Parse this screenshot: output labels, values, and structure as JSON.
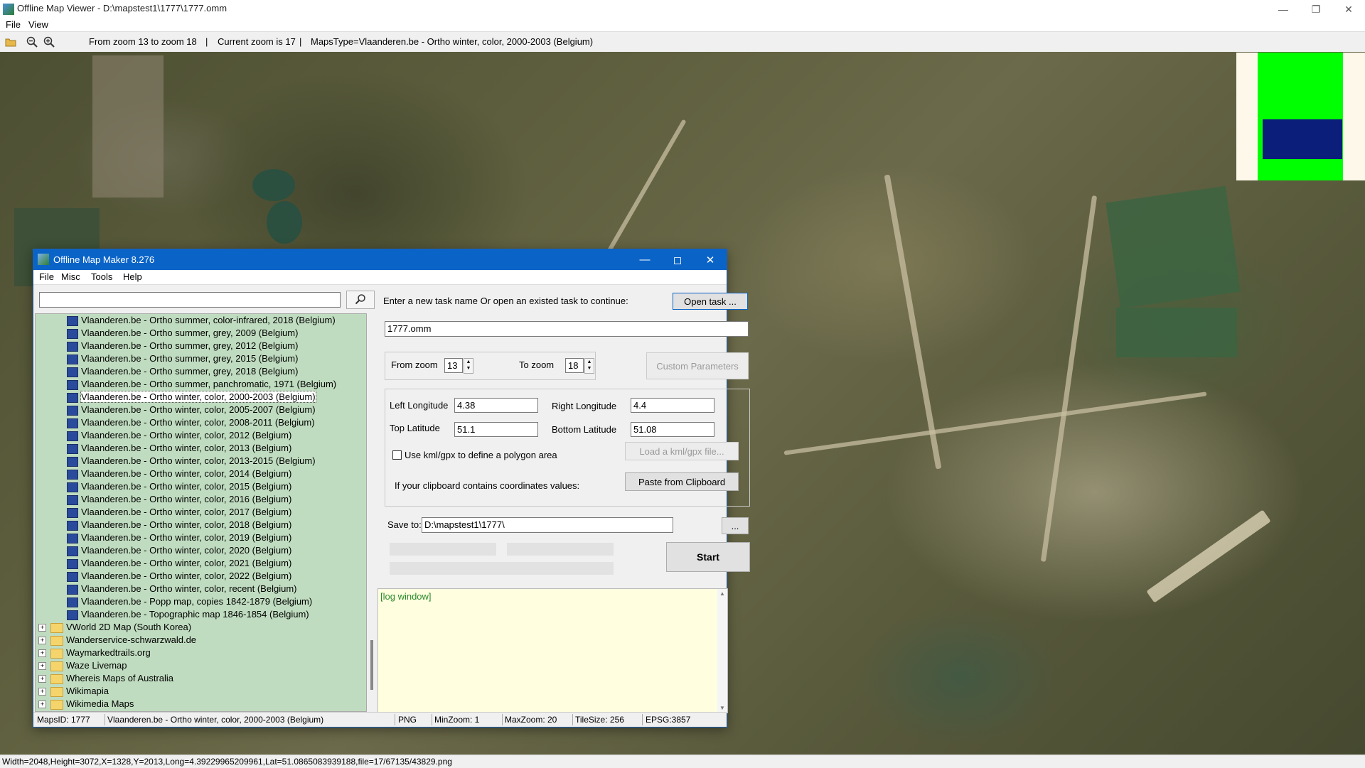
{
  "viewer": {
    "title": "Offline Map Viewer - D:\\mapstest1\\1777\\1777.omm",
    "menu": [
      "File",
      "View"
    ],
    "toolbar": {
      "zoom_range": "From zoom 13 to zoom 18",
      "separator": "|",
      "current_zoom": "Current zoom is 17",
      "separator2": "|",
      "maps_type": "MapsType=Vlaanderen.be - Ortho winter, color, 2000-2003 (Belgium)",
      "icons": [
        "folder-open-icon",
        "zoom-out-icon",
        "zoom-in-icon"
      ]
    },
    "status": "Width=2048,Height=3072,X=1328,Y=2013,Long=4.39229965209961,Lat=51.0865083939188,file=17/67135/43829.png",
    "overview_colors": {
      "background": "#fdf8ea",
      "frame": "#00ff00",
      "viewport": "#0a1e7a"
    }
  },
  "dialog": {
    "title": "Offline Map Maker 8.276",
    "menu": [
      "File",
      "Misc",
      "Tools",
      "Help"
    ],
    "search": {
      "value": "",
      "icon": "search-icon"
    },
    "tree_items": [
      {
        "label": "Vlaanderen.be - Ortho summer, color-infrared, 2018 (Belgium)",
        "type": "map"
      },
      {
        "label": "Vlaanderen.be - Ortho summer, grey, 2009 (Belgium)",
        "type": "map"
      },
      {
        "label": "Vlaanderen.be - Ortho summer, grey, 2012 (Belgium)",
        "type": "map"
      },
      {
        "label": "Vlaanderen.be - Ortho summer, grey, 2015 (Belgium)",
        "type": "map"
      },
      {
        "label": "Vlaanderen.be - Ortho summer, grey, 2018 (Belgium)",
        "type": "map"
      },
      {
        "label": "Vlaanderen.be - Ortho summer, panchromatic, 1971 (Belgium)",
        "type": "map"
      },
      {
        "label": "Vlaanderen.be - Ortho winter, color, 2000-2003 (Belgium)",
        "type": "map",
        "selected": true
      },
      {
        "label": "Vlaanderen.be - Ortho winter, color, 2005-2007 (Belgium)",
        "type": "map"
      },
      {
        "label": "Vlaanderen.be - Ortho winter, color, 2008-2011 (Belgium)",
        "type": "map"
      },
      {
        "label": "Vlaanderen.be - Ortho winter, color, 2012 (Belgium)",
        "type": "map"
      },
      {
        "label": "Vlaanderen.be - Ortho winter, color, 2013 (Belgium)",
        "type": "map"
      },
      {
        "label": "Vlaanderen.be - Ortho winter, color, 2013-2015 (Belgium)",
        "type": "map"
      },
      {
        "label": "Vlaanderen.be - Ortho winter, color, 2014 (Belgium)",
        "type": "map"
      },
      {
        "label": "Vlaanderen.be - Ortho winter, color, 2015 (Belgium)",
        "type": "map"
      },
      {
        "label": "Vlaanderen.be - Ortho winter, color, 2016 (Belgium)",
        "type": "map"
      },
      {
        "label": "Vlaanderen.be - Ortho winter, color, 2017 (Belgium)",
        "type": "map"
      },
      {
        "label": "Vlaanderen.be - Ortho winter, color, 2018 (Belgium)",
        "type": "map"
      },
      {
        "label": "Vlaanderen.be - Ortho winter, color, 2019 (Belgium)",
        "type": "map"
      },
      {
        "label": "Vlaanderen.be - Ortho winter, color, 2020 (Belgium)",
        "type": "map"
      },
      {
        "label": "Vlaanderen.be - Ortho winter, color, 2021 (Belgium)",
        "type": "map"
      },
      {
        "label": "Vlaanderen.be - Ortho winter, color, 2022 (Belgium)",
        "type": "map"
      },
      {
        "label": "Vlaanderen.be - Ortho winter, color, recent (Belgium)",
        "type": "map"
      },
      {
        "label": "Vlaanderen.be - Popp map, copies 1842-1879 (Belgium)",
        "type": "map"
      },
      {
        "label": "Vlaanderen.be - Topographic map 1846-1854 (Belgium)",
        "type": "map"
      },
      {
        "label": "VWorld 2D Map (South Korea)",
        "type": "folder"
      },
      {
        "label": "Wanderservice-schwarzwald.de",
        "type": "folder"
      },
      {
        "label": "Waymarkedtrails.org",
        "type": "folder"
      },
      {
        "label": "Waze Livemap",
        "type": "folder"
      },
      {
        "label": "Whereis Maps of Australia",
        "type": "folder"
      },
      {
        "label": "Wikimapia",
        "type": "folder"
      },
      {
        "label": "Wikimedia Maps",
        "type": "folder"
      }
    ],
    "task_prompt": "Enter a new task name Or open an existed task to continue:",
    "open_task_label": "Open task ...",
    "task_name": "1777.omm",
    "from_zoom_label": "From zoom",
    "from_zoom": "13",
    "to_zoom_label": "To zoom",
    "to_zoom": "18",
    "custom_params_label": "Custom Parameters",
    "left_lon_label": "Left Longitude",
    "left_lon": "4.38",
    "right_lon_label": "Right Longitude",
    "right_lon": "4.4",
    "top_lat_label": "Top Latitude",
    "top_lat": "51.1",
    "bottom_lat_label": "Bottom Latitude",
    "bottom_lat": "51.08",
    "kml_label": "Use kml/gpx to define a polygon area",
    "load_kml_label": "Load a kml/gpx file...",
    "clipboard_prompt": "If your clipboard contains coordinates values:",
    "paste_label": "Paste from Clipboard",
    "save_to_label": "Save to:",
    "save_to": "D:\\mapstest1\\1777\\",
    "browse_label": "...",
    "start_label": "Start",
    "log_label": "[log window]",
    "status": {
      "maps_id": "MapsID: 1777",
      "map_name": "Vlaanderen.be - Ortho winter, color, 2000-2003 (Belgium)",
      "format": "PNG",
      "min_zoom": "MinZoom: 1",
      "max_zoom": "MaxZoom: 20",
      "tile_size": "TileSize: 256",
      "epsg": "EPSG:3857"
    }
  }
}
